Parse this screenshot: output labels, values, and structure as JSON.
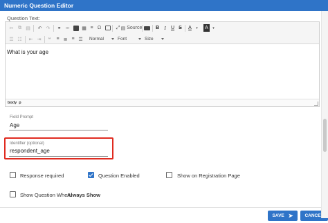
{
  "window": {
    "title": "Numeric Question Editor"
  },
  "question_text": {
    "label": "Question Text:",
    "content": "What is your age",
    "statusbar": {
      "path_body": "body",
      "path_p": "p"
    },
    "toolbar": {
      "source_label": "Source",
      "format_label": "Normal",
      "font_label": "Font",
      "size_label": "Size",
      "bold": "B",
      "italic": "I",
      "underline": "U",
      "strike": "S",
      "text_color": "A",
      "bg_color": "A",
      "omega": "Ω"
    }
  },
  "field_prompt": {
    "label": "Field Prompt",
    "value": "Age"
  },
  "identifier": {
    "label": "Identifier (optional)",
    "value": "respondent_age"
  },
  "options": {
    "response_required": {
      "label": "Response required",
      "checked": false
    },
    "question_enabled": {
      "label": "Question Enabled",
      "checked": true
    },
    "show_on_registration": {
      "label": "Show on Registration Page",
      "checked": false
    },
    "show_question_when": {
      "label": "Show Question When:",
      "value": "Always Show",
      "checked": false
    }
  },
  "footer": {
    "save_label": "SAVE",
    "cancel_label": "CANCEL"
  },
  "colors": {
    "accent": "#2f74c8",
    "highlight_border": "#e02b20"
  }
}
